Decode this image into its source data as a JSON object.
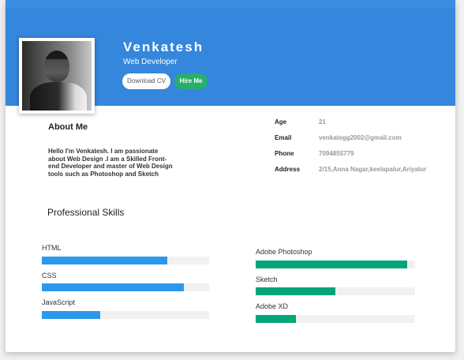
{
  "profile": {
    "name": "Venkatesh",
    "role": "Web Developer",
    "download_label": "Download CV",
    "hire_label": "Hire Me"
  },
  "about": {
    "title": "About Me",
    "text": "Hello I'm Venkatesh. I am passionate about Web Design .I am a Skilled Front-end Developer and master of Web Design tools such as Photoshop and Sketch"
  },
  "info": [
    {
      "label": "Age",
      "value": "21"
    },
    {
      "label": "Email",
      "value": "venkategg2002@gmail.com"
    },
    {
      "label": "Phone",
      "value": "7094855779"
    },
    {
      "label": "Address",
      "value": "2/15,Anna Nagar,keelapalur,Ariyalur"
    }
  ],
  "skills": {
    "title": "Professional Skills",
    "left": [
      {
        "name": "HTML",
        "level": 0.75
      },
      {
        "name": "CSS",
        "level": 0.85
      },
      {
        "name": "JavaScript",
        "level": 0.35
      }
    ],
    "right": [
      {
        "name": "Adobe Photoshop",
        "level": 0.95
      },
      {
        "name": "Sketch",
        "level": 0.5
      },
      {
        "name": "Adobe XD",
        "level": 0.25
      }
    ]
  },
  "colors": {
    "header": "#3487dc",
    "hire_button": "#26b06b",
    "bar_blue": "#2c98ec",
    "bar_green": "#02a67a"
  }
}
